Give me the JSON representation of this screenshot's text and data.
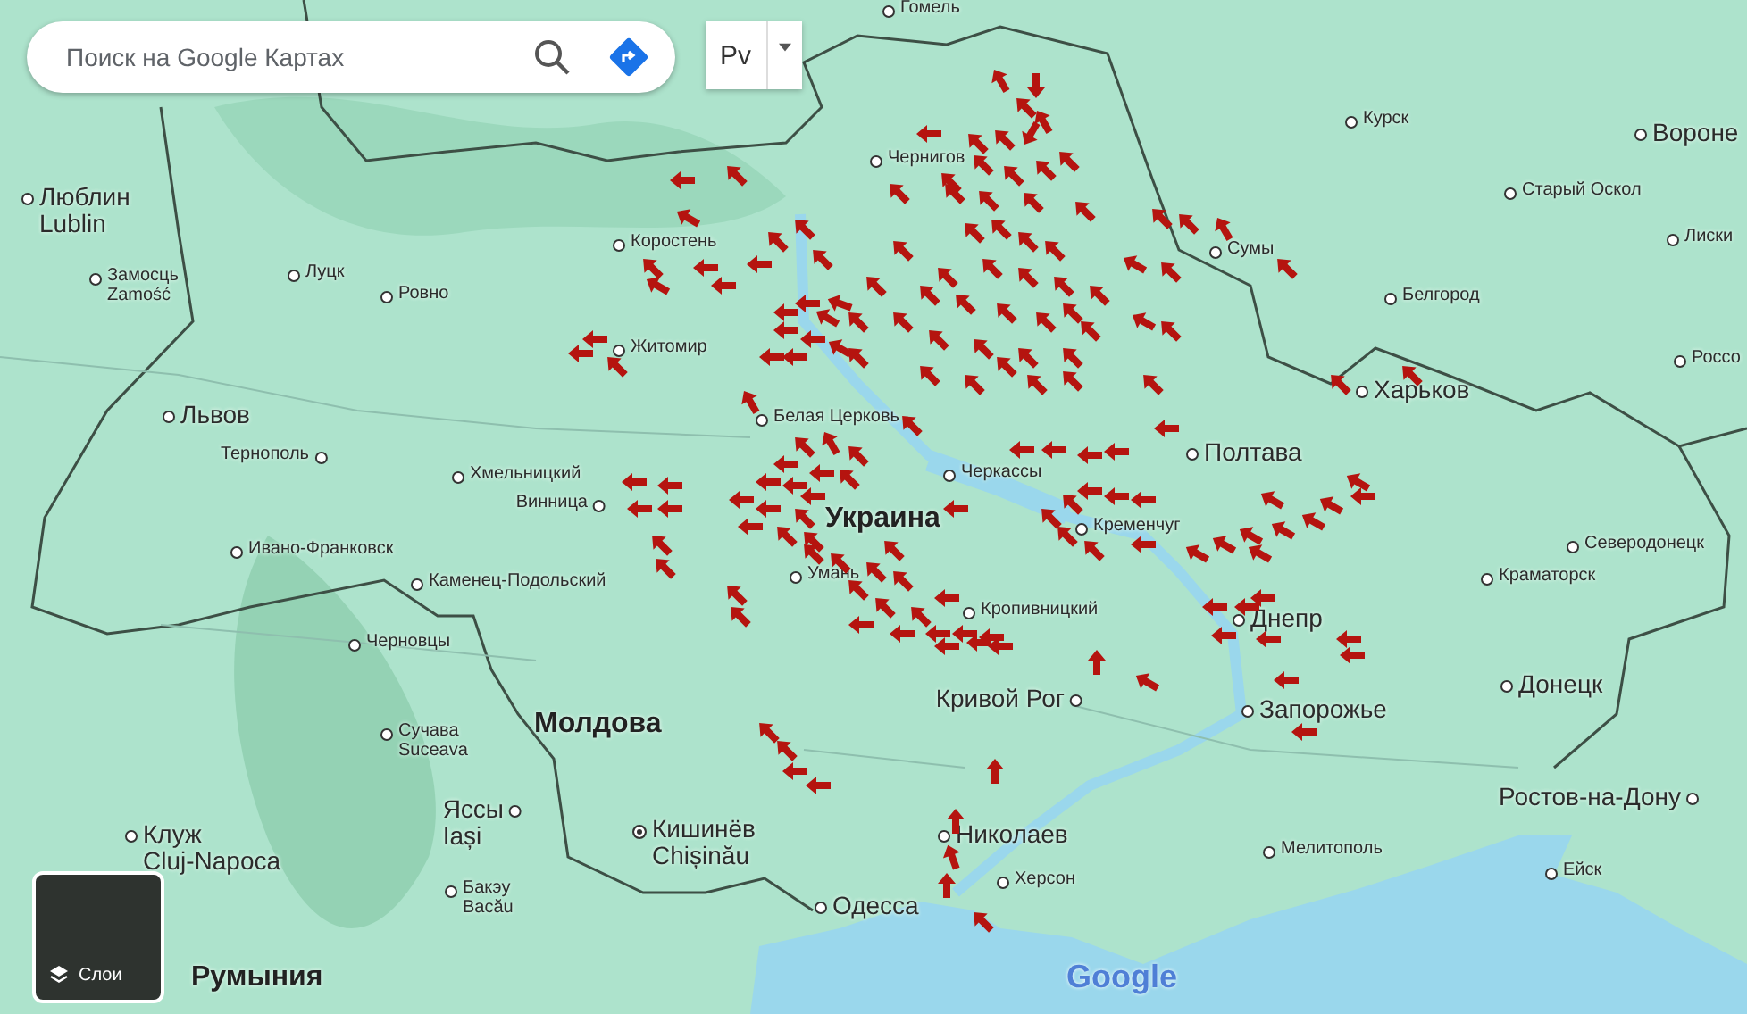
{
  "search": {
    "placeholder": "Поиск на Google Картах"
  },
  "language_button": {
    "label": "Pv"
  },
  "map": {
    "labels": [
      {
        "text": "Гомель",
        "kind": "city"
      },
      {
        "text": "Курск",
        "kind": "city"
      },
      {
        "text": "Вороне",
        "kind": "major"
      },
      {
        "text": "Чернигов",
        "kind": "city"
      },
      {
        "text": "Люблин",
        "subtext": "Lublin",
        "kind": "major"
      },
      {
        "text": "Старый Оскол",
        "kind": "city"
      },
      {
        "text": "Коростень",
        "kind": "city"
      },
      {
        "text": "Сумы",
        "kind": "city"
      },
      {
        "text": "Лиски",
        "kind": "city"
      },
      {
        "text": "Замосць",
        "subtext": "Zamość",
        "kind": "city"
      },
      {
        "text": "Луцк",
        "kind": "city"
      },
      {
        "text": "Ровно",
        "kind": "city"
      },
      {
        "text": "Белгород",
        "kind": "city"
      },
      {
        "text": "Житомир",
        "kind": "city"
      },
      {
        "text": "Россо",
        "kind": "city"
      },
      {
        "text": "Львов",
        "kind": "major"
      },
      {
        "text": "Белая Церковь",
        "kind": "city"
      },
      {
        "text": "Харьков",
        "kind": "major"
      },
      {
        "text": "Тернополь",
        "kind": "city"
      },
      {
        "text": "Хмельницкий",
        "kind": "city"
      },
      {
        "text": "Черкассы",
        "kind": "city"
      },
      {
        "text": "Полтава",
        "kind": "major"
      },
      {
        "text": "Винница",
        "kind": "city"
      },
      {
        "text": "Украина",
        "kind": "country"
      },
      {
        "text": "Кременчуг",
        "kind": "city"
      },
      {
        "text": "Ивано-Франковск",
        "kind": "city"
      },
      {
        "text": "Северодонецк",
        "kind": "city"
      },
      {
        "text": "Каменец-Подольский",
        "kind": "city"
      },
      {
        "text": "Умань",
        "kind": "city"
      },
      {
        "text": "Краматорск",
        "kind": "city"
      },
      {
        "text": "Кропивницкий",
        "kind": "city"
      },
      {
        "text": "Днепр",
        "kind": "major"
      },
      {
        "text": "Черновцы",
        "kind": "city"
      },
      {
        "text": "Сучава",
        "subtext": "Suceava",
        "kind": "city"
      },
      {
        "text": "Молдова",
        "kind": "country"
      },
      {
        "text": "Кривой Рог",
        "kind": "major"
      },
      {
        "text": "Запорожье",
        "kind": "major"
      },
      {
        "text": "Донецк",
        "kind": "major"
      },
      {
        "text": "Яссы",
        "subtext": "Iași",
        "kind": "major"
      },
      {
        "text": "Ростов-на-Дону",
        "kind": "major"
      },
      {
        "text": "Клуж",
        "subtext": "Cluj-Napoca",
        "kind": "major"
      },
      {
        "text": "Кишинёв",
        "subtext": "Chișinău",
        "kind": "capital"
      },
      {
        "text": "Николаев",
        "kind": "major"
      },
      {
        "text": "Мелитополь",
        "kind": "city"
      },
      {
        "text": "Бакэу",
        "subtext": "Bacău",
        "kind": "city"
      },
      {
        "text": "Одесса",
        "kind": "major"
      },
      {
        "text": "Херсон",
        "kind": "city"
      },
      {
        "text": "Ейск",
        "kind": "city"
      },
      {
        "text": "Румыния",
        "kind": "country"
      }
    ]
  },
  "layers_button": {
    "label": "Слои"
  },
  "attribution": {
    "logo": "Google"
  }
}
